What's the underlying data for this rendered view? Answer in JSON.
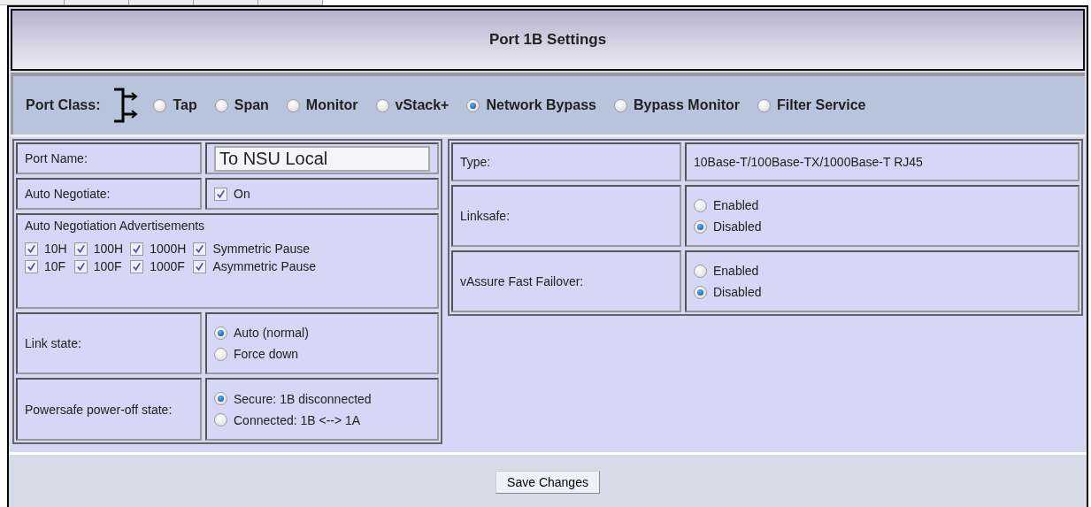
{
  "title": "Port 1B Settings",
  "port_class": {
    "label": "Port Class:",
    "options": [
      {
        "label": "Tap",
        "selected": false
      },
      {
        "label": "Span",
        "selected": false
      },
      {
        "label": "Monitor",
        "selected": false
      },
      {
        "label": "vStack+",
        "selected": false
      },
      {
        "label": "Network Bypass",
        "selected": true
      },
      {
        "label": "Bypass Monitor",
        "selected": false
      },
      {
        "label": "Filter Service",
        "selected": false
      }
    ]
  },
  "left_rows": [
    {
      "kind": "text_input",
      "label": "Port Name:",
      "value": "To NSU Local"
    },
    {
      "kind": "checkbox",
      "label": "Auto Negotiate:",
      "options": [
        {
          "label": "On",
          "checked": true
        }
      ]
    },
    {
      "kind": "checkbox_grid",
      "label": "Auto Negotiation Advertisements",
      "options": [
        {
          "label": "10H",
          "checked": true
        },
        {
          "label": "100H",
          "checked": true
        },
        {
          "label": "1000H",
          "checked": true
        },
        {
          "label": "Symmetric Pause",
          "checked": true
        },
        {
          "label": "10F",
          "checked": true
        },
        {
          "label": "100F",
          "checked": true
        },
        {
          "label": "1000F",
          "checked": true
        },
        {
          "label": "Asymmetric Pause",
          "checked": true
        }
      ]
    },
    {
      "kind": "radio",
      "label": "Link state:",
      "options": [
        {
          "label": "Auto (normal)",
          "selected": true
        },
        {
          "label": "Force down",
          "selected": false
        }
      ]
    },
    {
      "kind": "radio",
      "label": "Powersafe power-off state:",
      "options": [
        {
          "label": "Secure: 1B disconnected",
          "selected": true
        },
        {
          "label": "Connected: 1B <--> 1A",
          "selected": false
        }
      ]
    }
  ],
  "right_rows": [
    {
      "kind": "text",
      "label": "Type:",
      "value": "10Base-T/100Base-TX/1000Base-T RJ45"
    },
    {
      "kind": "radio",
      "label": "Linksafe:",
      "options": [
        {
          "label": "Enabled",
          "selected": false
        },
        {
          "label": "Disabled",
          "selected": true
        }
      ]
    },
    {
      "kind": "radio",
      "label": "vAssure Fast Failover:",
      "options": [
        {
          "label": "Enabled",
          "selected": false
        },
        {
          "label": "Disabled",
          "selected": true
        }
      ]
    }
  ],
  "save_button": "Save Changes"
}
